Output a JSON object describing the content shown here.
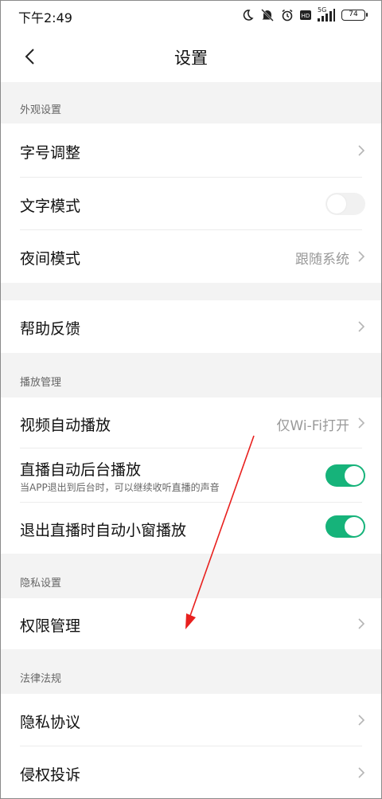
{
  "status_bar": {
    "time": "下午2:49",
    "network": "5G",
    "battery": "74"
  },
  "header": {
    "title": "设置",
    "back_icon": "chevron-left-icon"
  },
  "sections": {
    "appearance": {
      "title": "外观设置",
      "font_size": {
        "label": "字号调整"
      },
      "text_mode": {
        "label": "文字模式",
        "toggle": "off"
      },
      "night_mode": {
        "label": "夜间模式",
        "value": "跟随系统"
      }
    },
    "help": {
      "feedback": {
        "label": "帮助反馈"
      }
    },
    "playback": {
      "title": "播放管理",
      "autoplay": {
        "label": "视频自动播放",
        "value": "仅Wi-Fi打开"
      },
      "live_background": {
        "label": "直播自动后台播放",
        "sub": "当APP退出到后台时，可以继续收听直播的声音",
        "toggle": "on"
      },
      "live_mini_window": {
        "label": "退出直播时自动小窗播放",
        "toggle": "on"
      }
    },
    "privacy": {
      "title": "隐私设置",
      "permissions": {
        "label": "权限管理"
      }
    },
    "legal": {
      "title": "法律法规",
      "privacy_policy": {
        "label": "隐私协议"
      },
      "infringement": {
        "label": "侵权投诉"
      }
    }
  },
  "colors": {
    "toggle_on": "#16b37a",
    "annotation_arrow": "#e8201e",
    "section_bg": "#f3f3f3"
  }
}
